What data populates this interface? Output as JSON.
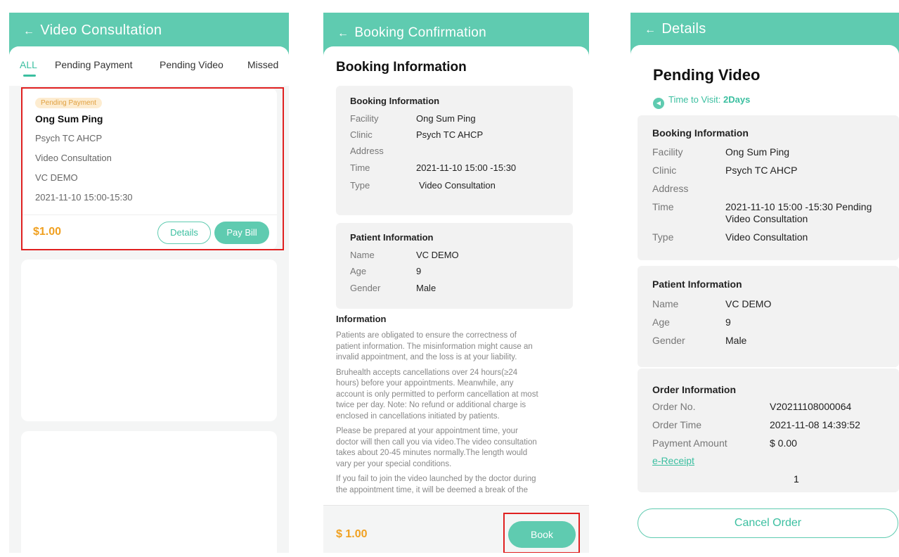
{
  "s1": {
    "title": "Video Consultation",
    "tabs": [
      "ALL",
      "Pending Payment",
      "Pending Video",
      "Missed"
    ],
    "order": {
      "status": "Pending Payment",
      "facility": "Ong Sum Ping",
      "clinic": "Psych TC AHCP",
      "type": "Video Consultation",
      "patient": "VC DEMO",
      "time": "2021-11-10 15:00-15:30",
      "price": "$1.00",
      "details_label": "Details",
      "pay_label": "Pay Bill"
    }
  },
  "s2": {
    "title": "Booking Confirmation",
    "heading": "Booking Information",
    "booking": {
      "title": "Booking Information",
      "rows": [
        {
          "k": "Facility",
          "v": "Ong Sum Ping"
        },
        {
          "k": "Clinic",
          "v": "Psych TC AHCP"
        },
        {
          "k": "Address",
          "v": ""
        },
        {
          "k": "Time",
          "v": "2021-11-10 15:00 -15:30"
        },
        {
          "k": "Type",
          "v": "Video Consultation"
        }
      ]
    },
    "patient": {
      "title": "Patient Information",
      "rows": [
        {
          "k": "Name",
          "v": "VC DEMO"
        },
        {
          "k": "Age",
          "v": "9"
        },
        {
          "k": "Gender",
          "v": "Male"
        }
      ]
    },
    "info_title": "Information",
    "info_lines": [
      "Patients are obligated to ensure the correctness of",
      "patient information. The misinformation might cause an",
      "invalid appointment, and the loss is at your liability.",
      "Bruhealth accepts cancellations over 24 hours(≥24",
      "hours) before your appointments. Meanwhile, any",
      "account is only permitted to perform cancellation at most",
      "twice per day. Note: No refund or additional charge is",
      "enclosed in cancellations initiated by patients.",
      "Please be prepared at your appointment time, your",
      "doctor will then call you via video.The video consultation",
      "takes about 20-45 minutes normally.The length would",
      "vary per your special conditions.",
      "If you fail to join the video launched by the doctor during",
      "the appointment time, it will be deemed a break of the"
    ],
    "price": "$ 1.00",
    "book_label": "Book"
  },
  "s3": {
    "title": "Details",
    "status": "Pending Video",
    "visit_label": "Time to Visit:",
    "visit_value": "2Days",
    "booking": {
      "title": "Booking Information",
      "facility_k": "Facility",
      "facility_v": "Ong Sum Ping",
      "clinic_k": "Clinic",
      "clinic_v": "Psych TC AHCP",
      "address_k": "Address",
      "time_k": "Time",
      "time_v1": "2021-11-10 15:00 -15:30 Pending",
      "time_v2": "Video Consultation",
      "type_k": "Type",
      "type_v": "Video Consultation"
    },
    "patient": {
      "title": "Patient Information",
      "rows": [
        {
          "k": "Name",
          "v": "VC DEMO"
        },
        {
          "k": "Age",
          "v": "9"
        },
        {
          "k": "Gender",
          "v": "Male"
        }
      ]
    },
    "order": {
      "title": "Order Information",
      "rows": [
        {
          "k": "Order No.",
          "v": "V20211108000064"
        },
        {
          "k": "Order Time",
          "v": "2021-11-08 14:39:52"
        },
        {
          "k": "Payment Amount",
          "v": "$ 0.00"
        }
      ],
      "receipt": "e-Receipt"
    },
    "annotation": "1",
    "cancel_label": "Cancel Order"
  },
  "colors": {
    "teal": "#5fcbb0",
    "price": "#f0a020",
    "red": "#e02020"
  }
}
